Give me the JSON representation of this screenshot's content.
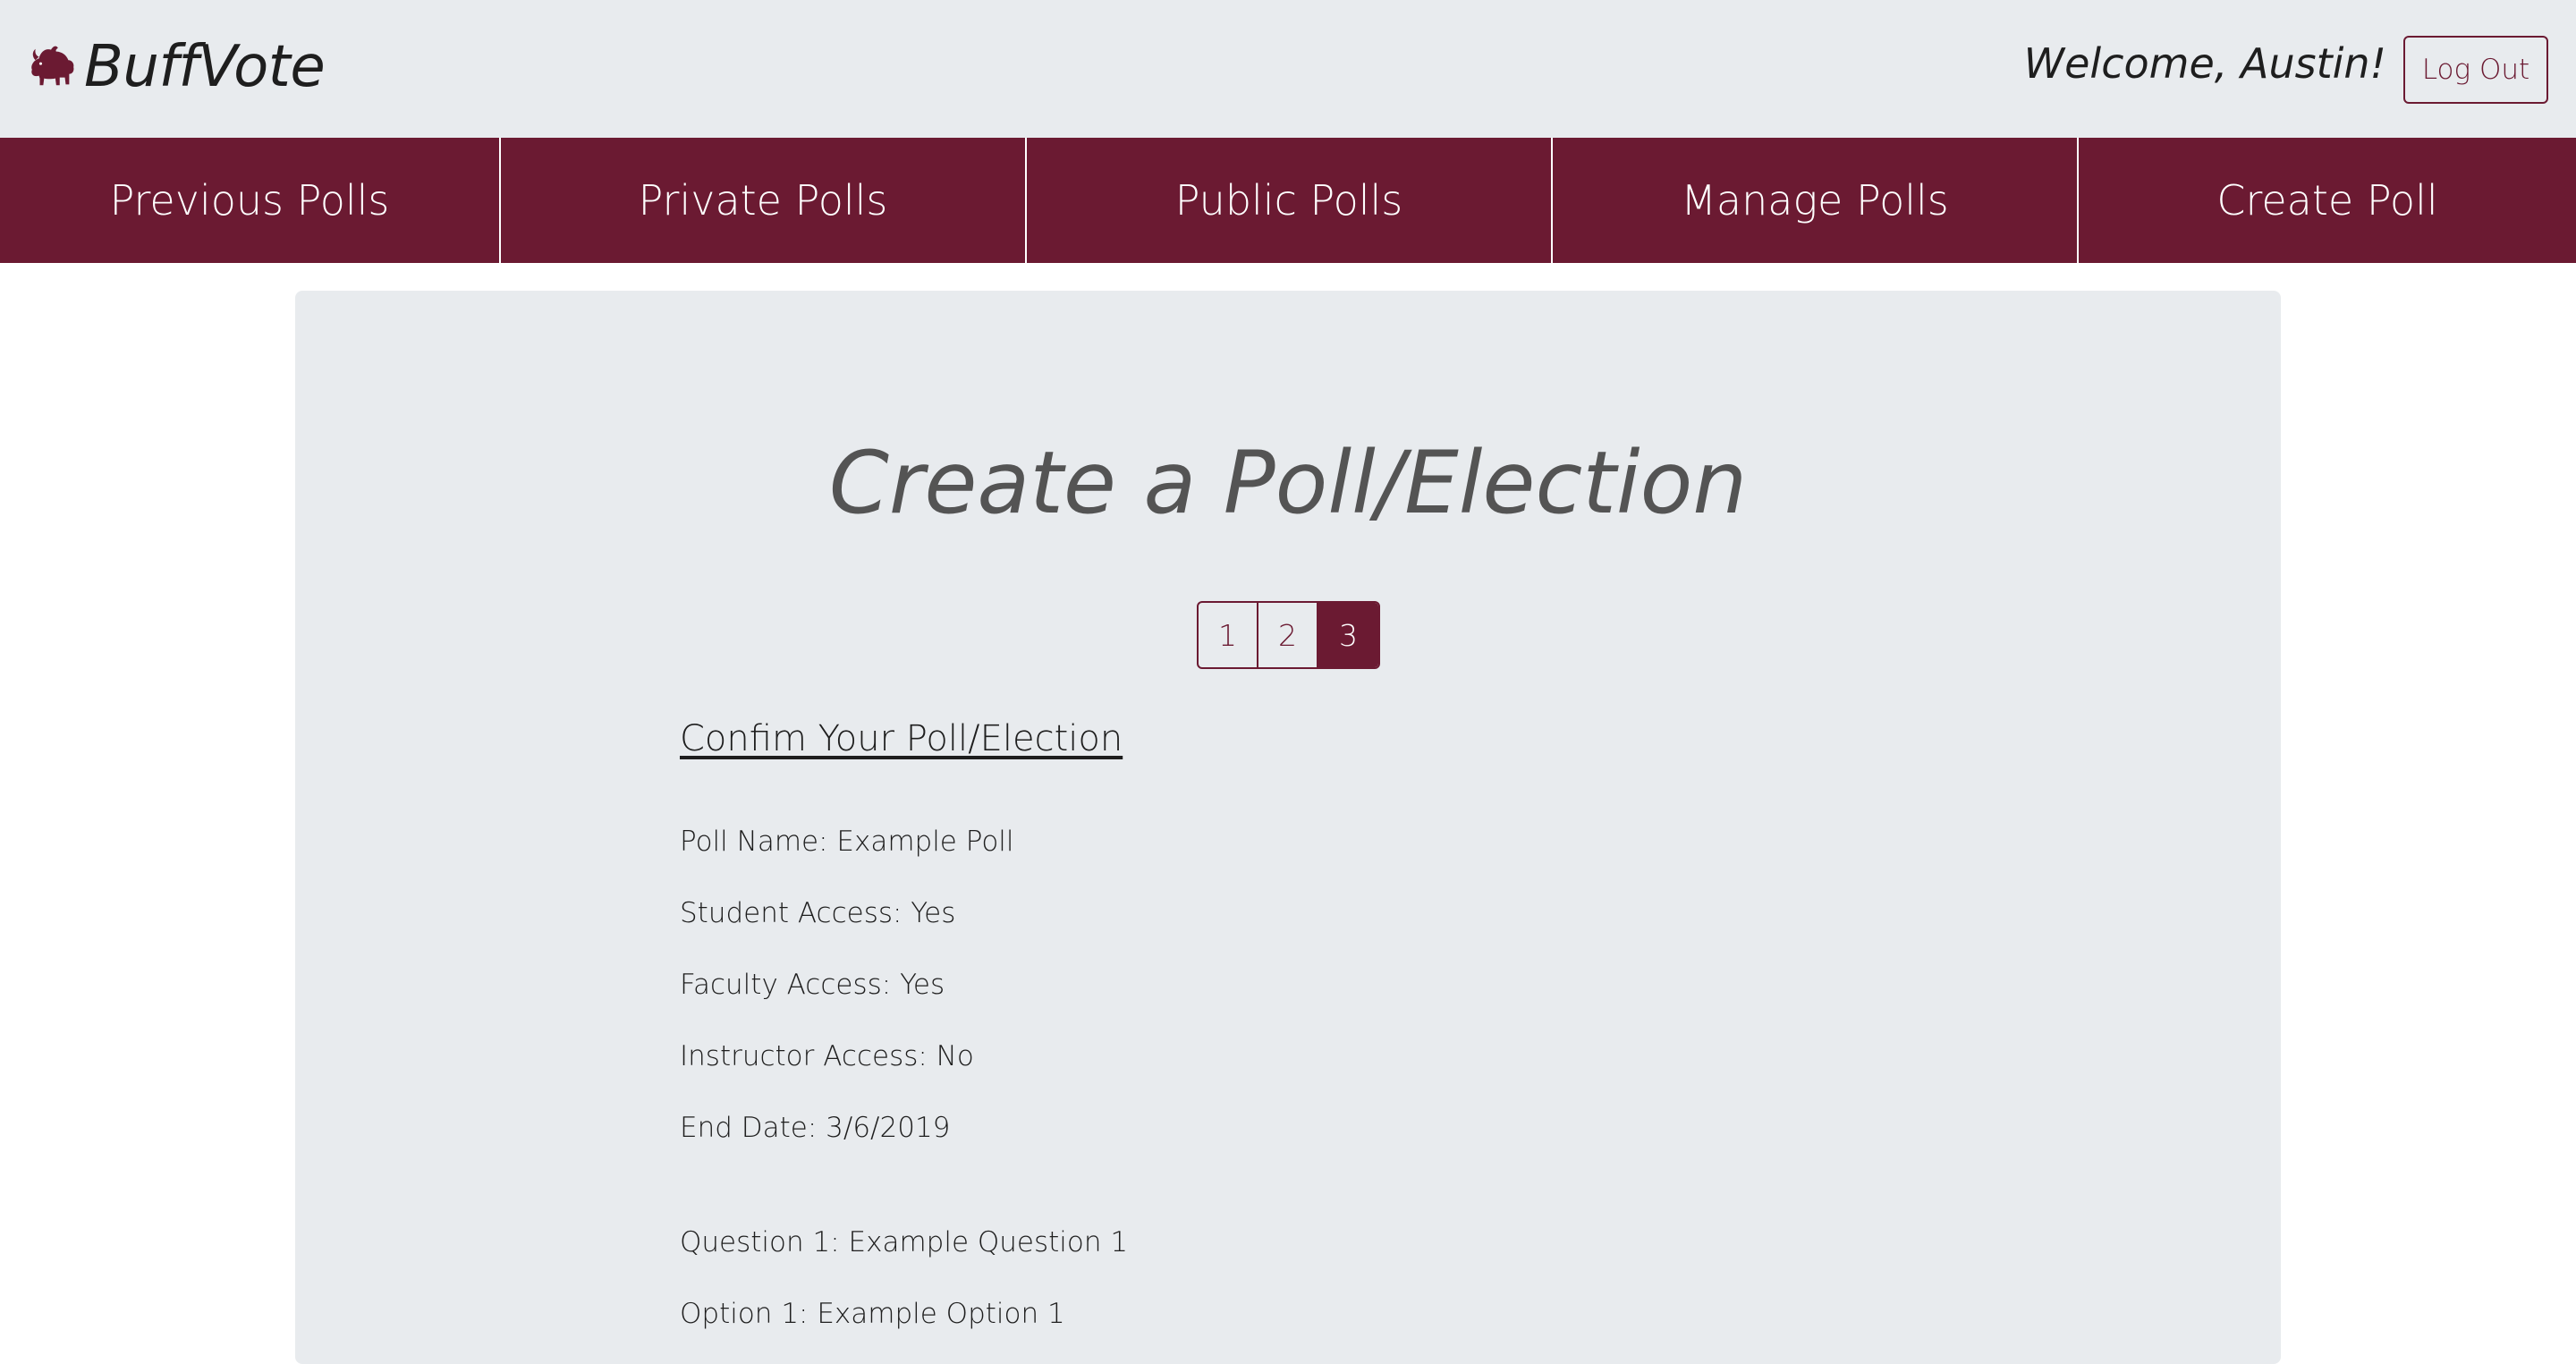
{
  "header": {
    "brand_name": "BuffVote",
    "welcome_text": "Welcome, Austin!",
    "logout_label": "Log Out"
  },
  "nav": {
    "items": [
      {
        "label": "Previous Polls"
      },
      {
        "label": "Private Polls"
      },
      {
        "label": "Public Polls"
      },
      {
        "label": "Manage Polls"
      },
      {
        "label": "Create Poll"
      }
    ]
  },
  "main": {
    "title": "Create a Poll/Election",
    "steps": [
      {
        "label": "1",
        "active": false
      },
      {
        "label": "2",
        "active": false
      },
      {
        "label": "3",
        "active": true
      }
    ],
    "confirm_heading": "Confim Your Poll/Election",
    "details": [
      "Poll Name: Example Poll",
      "Student Access: Yes",
      "Faculty Access: Yes",
      "Instructor Access: No",
      "End Date: 3/6/2019",
      "Question 1: Example Question 1",
      "Option 1: Example Option 1"
    ]
  },
  "colors": {
    "accent": "#6b1a32",
    "header_bg": "#e8ebee",
    "card_bg": "#e8ebee",
    "text": "#1e1e1e",
    "title_text": "#545454"
  },
  "icons": {
    "brand_logo": "buffalo-icon"
  }
}
